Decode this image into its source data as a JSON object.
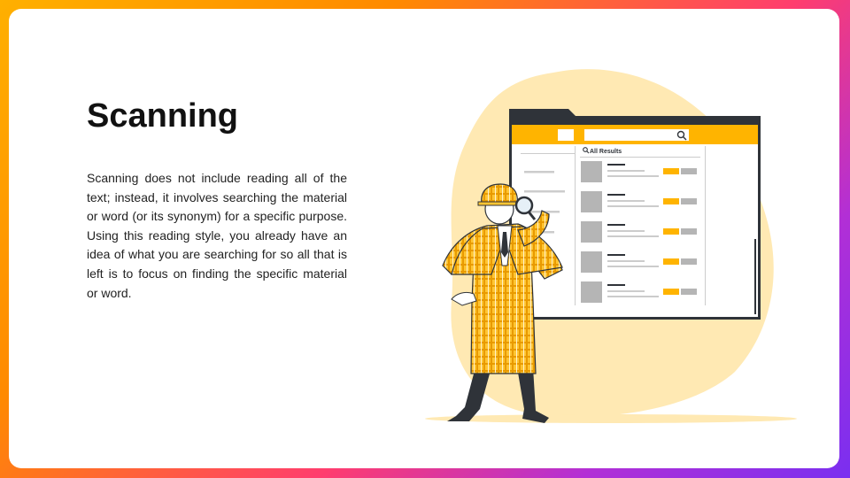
{
  "slide": {
    "title": "Scanning",
    "body": "Scanning does not include reading all of the text; instead, it involves searching the material or word (or its synonym) for a specific purpose. Using this reading style, you already have an idea of what you are searching for so all that is left is to focus on finding the specific material or word."
  },
  "illustration": {
    "results_label": "All Results",
    "icons": [
      "search-icon",
      "magnifying-glass-icon"
    ],
    "colors": {
      "accent": "#ffb400",
      "blob": "#ffe9b3",
      "dark": "#2f3339",
      "placeholder": "#b5b5b5"
    }
  }
}
